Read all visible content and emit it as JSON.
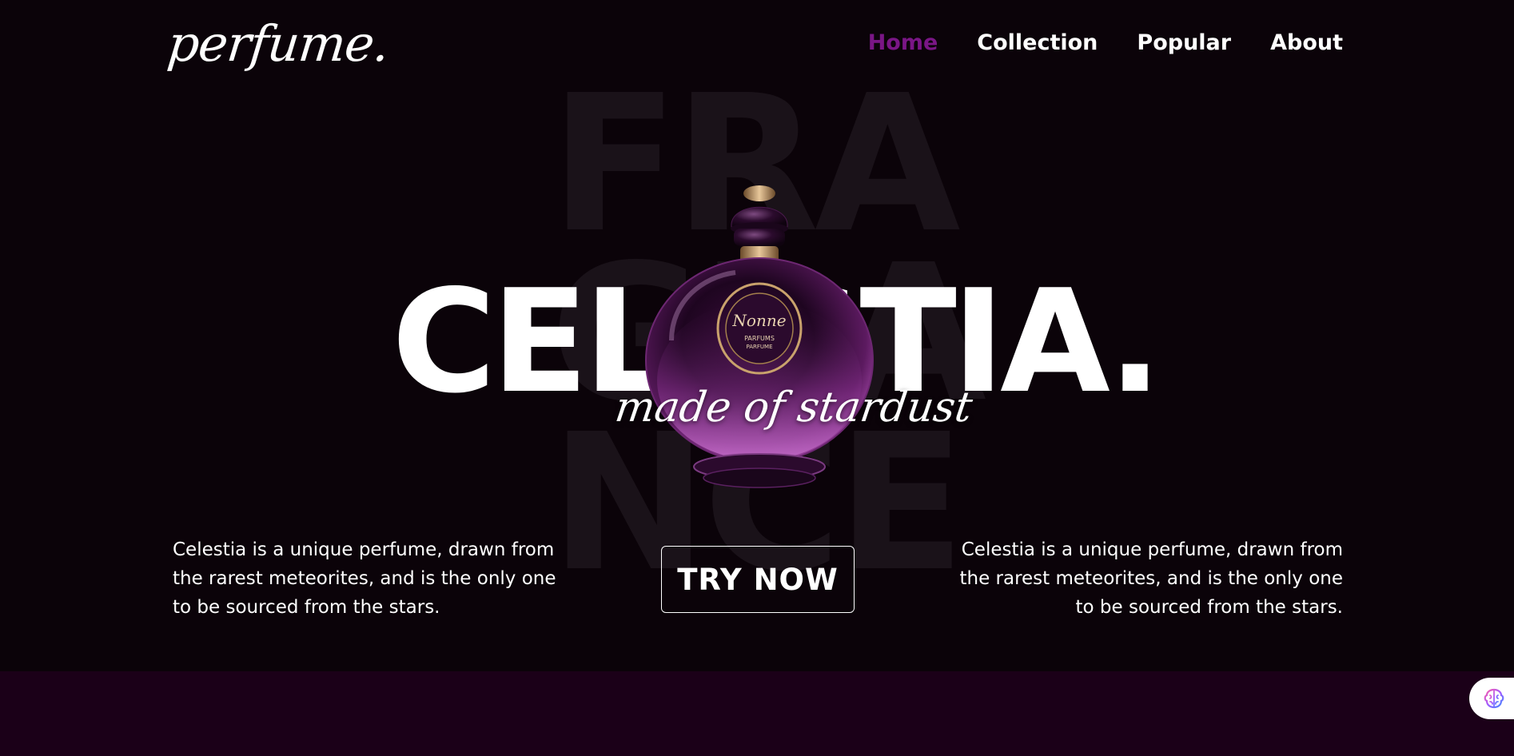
{
  "brand": {
    "logo_text": "perfume."
  },
  "nav": {
    "items": [
      {
        "label": "Home",
        "active": true
      },
      {
        "label": "Collection",
        "active": false
      },
      {
        "label": "Popular",
        "active": false
      },
      {
        "label": "About",
        "active": false
      }
    ]
  },
  "hero": {
    "watermark_text": "FRAGRANCE",
    "title": "CELESTIA.",
    "tagline": "made of stardust",
    "bottle_label_line1": "Nonne",
    "bottle_label_line2": "PARFUMS",
    "bottle_label_line3": "PARFUME"
  },
  "descriptions": {
    "left": "Celestia is a unique perfume, drawn from the rarest meteorites, and is the only one to be sourced from the stars.",
    "right": "Celestia is a unique perfume, drawn from the rarest meteorites, and is the only one to be sourced from the stars."
  },
  "cta": {
    "label": "TRY NOW"
  },
  "colors": {
    "background": "#0b0309",
    "accent": "#7a1686",
    "band": "#1b0018",
    "watermark": "#1a1219"
  },
  "icons": {
    "floating_widget": "brain-icon"
  }
}
